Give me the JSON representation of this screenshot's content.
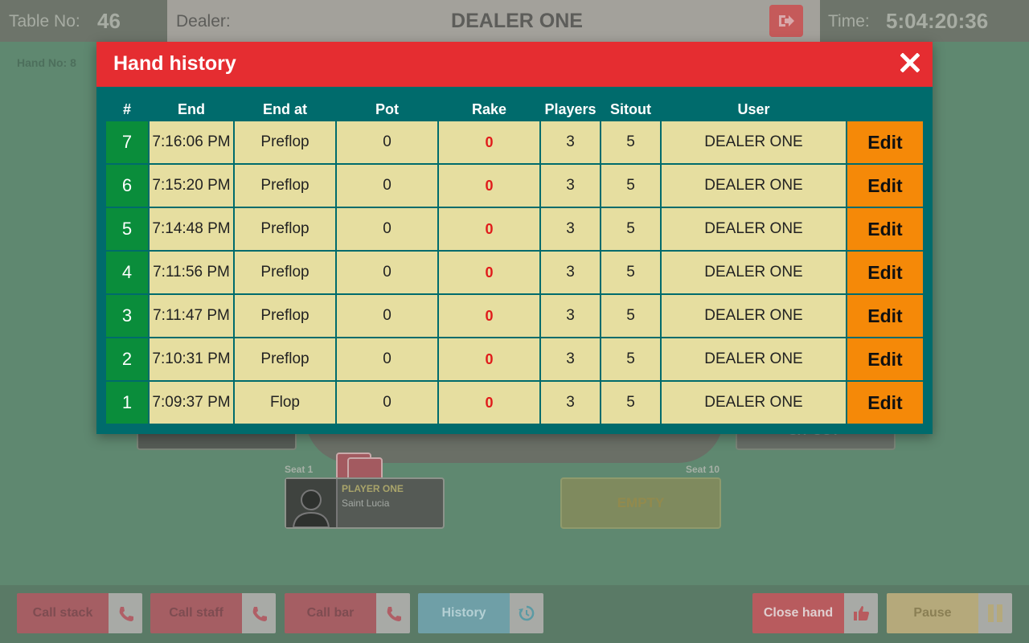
{
  "topbar": {
    "table_label": "Table No:",
    "table_value": "46",
    "dealer_label": "Dealer:",
    "dealer_value": "DEALER ONE",
    "logout_icon": "logout-icon",
    "time_label": "Time:",
    "time_value": "5:04:20:36"
  },
  "hand_no": "Hand No: 8",
  "background_table": {
    "seat1_label": "Seat 1",
    "seat10_label": "Seat 10",
    "player_name": "PLAYER ONE",
    "player_country": "Saint Lucia",
    "empty_label": "EMPTY",
    "sitout_label": "SIT OUT"
  },
  "modal": {
    "title": "Hand history",
    "close_icon": "close-icon",
    "columns": [
      "#",
      "End",
      "End at",
      "Pot",
      "Rake",
      "Players",
      "Sitout",
      "User"
    ],
    "edit_label": "Edit",
    "rows": [
      {
        "num": "7",
        "end": "7:16:06 PM",
        "end_at": "Preflop",
        "pot": "0",
        "rake": "0",
        "players": "3",
        "sitout": "5",
        "user": "DEALER ONE"
      },
      {
        "num": "6",
        "end": "7:15:20 PM",
        "end_at": "Preflop",
        "pot": "0",
        "rake": "0",
        "players": "3",
        "sitout": "5",
        "user": "DEALER ONE"
      },
      {
        "num": "5",
        "end": "7:14:48 PM",
        "end_at": "Preflop",
        "pot": "0",
        "rake": "0",
        "players": "3",
        "sitout": "5",
        "user": "DEALER ONE"
      },
      {
        "num": "4",
        "end": "7:11:56 PM",
        "end_at": "Preflop",
        "pot": "0",
        "rake": "0",
        "players": "3",
        "sitout": "5",
        "user": "DEALER ONE"
      },
      {
        "num": "3",
        "end": "7:11:47 PM",
        "end_at": "Preflop",
        "pot": "0",
        "rake": "0",
        "players": "3",
        "sitout": "5",
        "user": "DEALER ONE"
      },
      {
        "num": "2",
        "end": "7:10:31 PM",
        "end_at": "Preflop",
        "pot": "0",
        "rake": "0",
        "players": "3",
        "sitout": "5",
        "user": "DEALER ONE"
      },
      {
        "num": "1",
        "end": "7:09:37 PM",
        "end_at": "Flop",
        "pot": "0",
        "rake": "0",
        "players": "3",
        "sitout": "5",
        "user": "DEALER ONE"
      }
    ]
  },
  "bottombar": {
    "call_stack": "Call stack",
    "call_staff": "Call staff",
    "call_bar": "Call bar",
    "history": "History",
    "close_hand": "Close hand",
    "pause": "Pause"
  },
  "colors": {
    "modal_header": "#e52d31",
    "modal_body": "#006b6c",
    "row_num": "#0a8d3b",
    "cell": "#e6dea0",
    "edit": "#f58908",
    "rake_text": "#e01b1b"
  }
}
